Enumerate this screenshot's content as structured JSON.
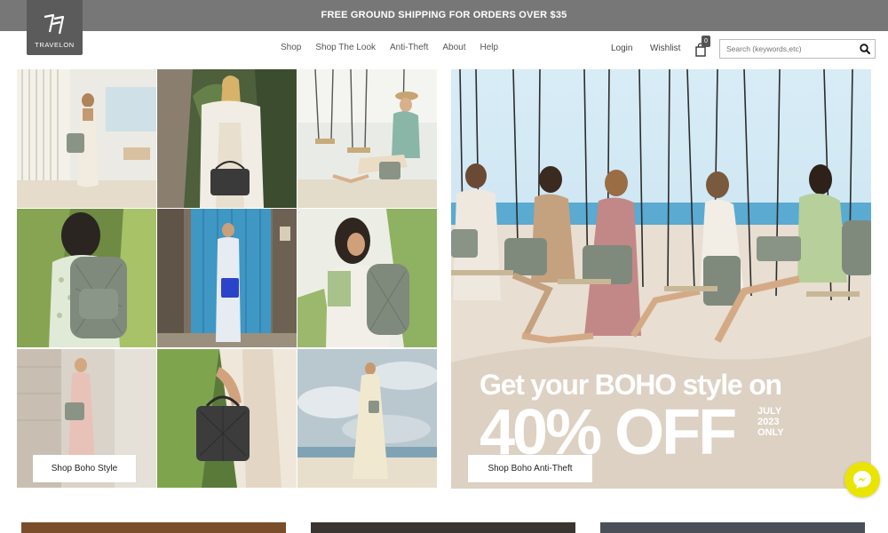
{
  "promo": {
    "text": "FREE GROUND SHIPPING FOR ORDERS OVER $35"
  },
  "brand": {
    "name": "TRAVELON"
  },
  "nav": {
    "items": [
      "Shop",
      "Shop The Look",
      "Anti-Theft",
      "About",
      "Help"
    ]
  },
  "account": {
    "login": "Login",
    "wishlist": "Wishlist",
    "cart_count": "0"
  },
  "search": {
    "placeholder": "Search (keywords,etc)"
  },
  "left_panel": {
    "cta": "Shop Boho Style"
  },
  "hero": {
    "line1": "Get your BOHO style on",
    "line2": "40% OFF",
    "date_line1": "JULY",
    "date_line2": "2023",
    "date_line3": "ONLY",
    "cta": "Shop Boho Anti-Theft"
  },
  "colors": {
    "promo_bg": "#777777",
    "logo_bg": "#5b5b5b",
    "messenger": "#e9e400",
    "bag_gray": "#7f8a7d"
  },
  "icons": {
    "cart": "shopping-bag-icon",
    "search": "search-icon",
    "chat": "messenger-icon"
  }
}
